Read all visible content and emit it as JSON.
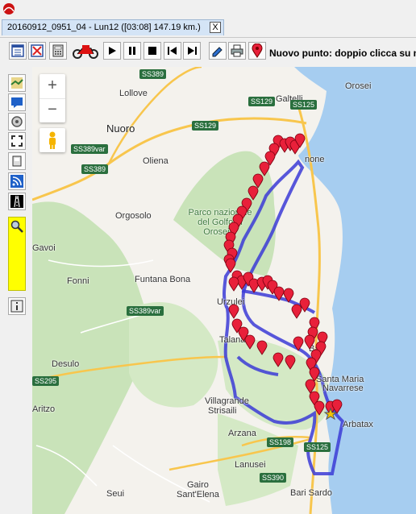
{
  "window": {
    "title": "",
    "app_icon": "app-logo-icon"
  },
  "tab": {
    "label": "20160912_0951_04 - Lun12 ([03:08] 147.19 km.)",
    "close_symbol": "X"
  },
  "toolbar": {
    "buttons": [
      "calendar-grid-icon",
      "calendar-cross-icon",
      "calculator-icon",
      "motorcycle-icon",
      "play-icon",
      "pause-icon",
      "stop-icon",
      "skip-start-icon",
      "skip-end-icon",
      "edit-icon",
      "print-icon",
      "map-pin-icon"
    ],
    "hint_text": "Nuovo punto: doppio clicca su ma"
  },
  "sidebar": {
    "buttons": [
      "map-layer-icon",
      "message-icon",
      "target-icon",
      "fullscreen-icon",
      "device-icon",
      "feed-icon",
      "road-icon",
      "search-icon",
      "info-icon"
    ]
  },
  "map": {
    "zoom_in": "+",
    "zoom_out": "−",
    "cities": {
      "nuoro": "Nuoro"
    },
    "towns": {
      "galtelli": "Galtelli",
      "orosei": "Orosei",
      "lollove": "Lollove",
      "oliena": "Oliena",
      "orgosolo": "Orgosolo",
      "gavoi": "Gavoi",
      "fonni": "Fonni",
      "funtana_bona": "Funtana Bona",
      "urzulei": "Urzulei",
      "talana": "Talana",
      "desulo": "Desulo",
      "aritzo": "Aritzo",
      "villagrande": "Villagrande",
      "strisaili": "Strisaili",
      "arzana": "Arzana",
      "lanusei": "Lanusei",
      "seui": "Seui",
      "gairo": "Gairo",
      "sant_elena": "Sant'Elena",
      "bari_sardo": "Bari Sardo",
      "baunei": "Bau",
      "santa_maria": "Santa Maria",
      "navarrese": "Navarrese",
      "arbatax": "Arbatax",
      "cala_gonone": "none"
    },
    "park": "Parco nazionale del Golfo di Orosei e",
    "roads": [
      "SS389",
      "SS129",
      "SS125",
      "SS389var",
      "SS389",
      "SS129",
      "SS389var",
      "SS295",
      "SS198",
      "SS125",
      "SS390"
    ],
    "colors": {
      "route": "#3b3bd6",
      "marker": "#e8203a",
      "land": "#f4f2ed",
      "forest": "#c9e3b9",
      "sea": "#a6cdf0",
      "road": "#f8c64d"
    }
  }
}
